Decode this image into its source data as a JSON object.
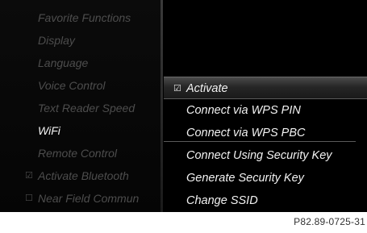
{
  "left_menu": {
    "items": [
      {
        "label": "Favorite Functions"
      },
      {
        "label": "Display"
      },
      {
        "label": "Language"
      },
      {
        "label": "Voice Control"
      },
      {
        "label": "Text Reader Speed"
      },
      {
        "label": "WiFi",
        "active": true
      },
      {
        "label": "Remote Control"
      },
      {
        "label": "Activate Bluetooth",
        "checkbox": "☑"
      },
      {
        "label": "Near Field Commun",
        "checkbox": "☐"
      }
    ]
  },
  "right_panel": {
    "items": [
      {
        "label": "Activate",
        "checkbox": "☑",
        "selected": true
      },
      {
        "label": "Connect via WPS PIN"
      },
      {
        "label": "Connect via WPS PBC"
      },
      {
        "label": "Connect Using Security Key"
      },
      {
        "label": "Generate Security Key"
      },
      {
        "label": "Change SSID"
      }
    ]
  },
  "caption": "P82.89-0725-31",
  "colors": {
    "background": "#000000",
    "text_active": "#f2f2f2",
    "text_dim": "#4d4d4d"
  }
}
